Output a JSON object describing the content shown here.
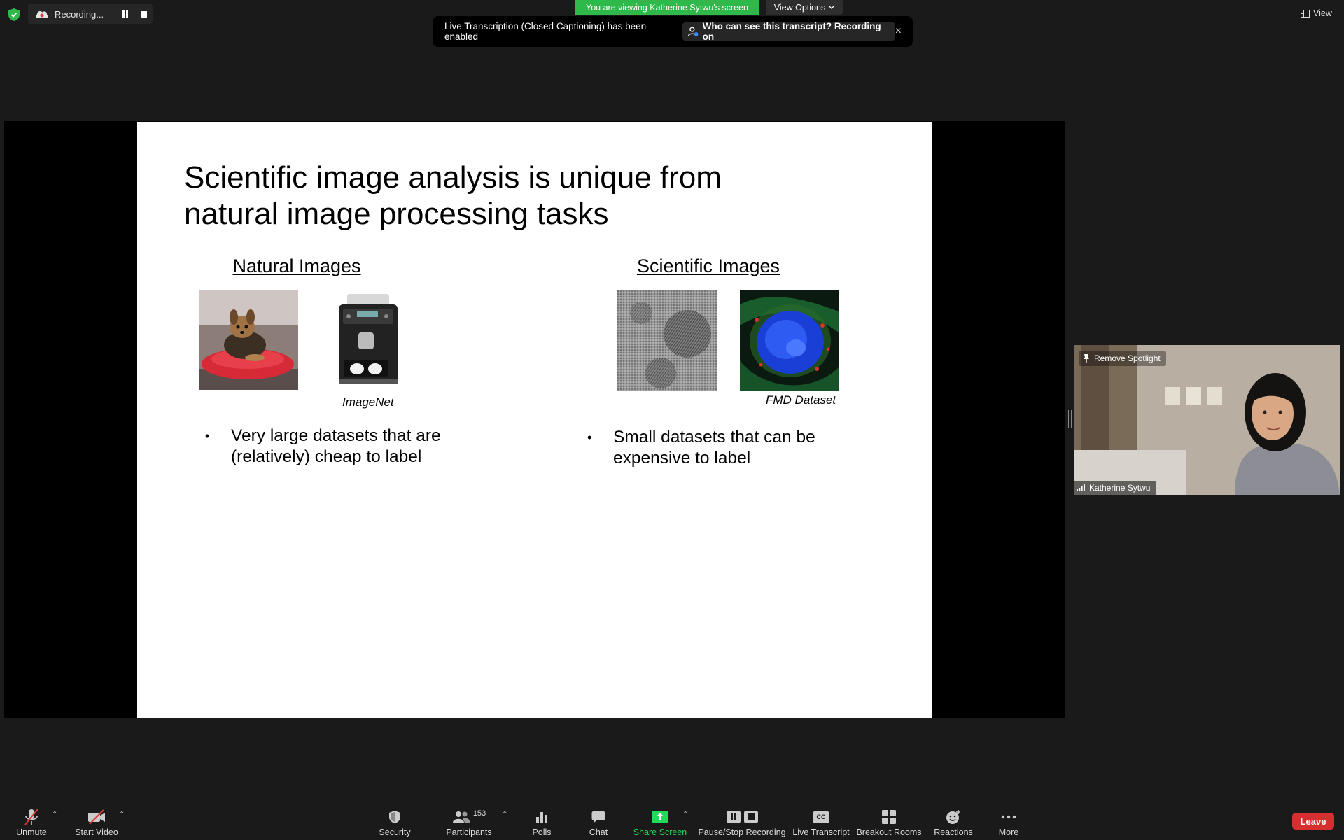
{
  "recording": {
    "label": "Recording..."
  },
  "banner": {
    "viewing": "You are viewing Katherine Sytwu's screen",
    "view_options": "View Options"
  },
  "transcript_notice": {
    "text": "Live Transcription (Closed Captioning) has been enabled",
    "who_label": "Who can see this transcript? Recording on",
    "close": "×"
  },
  "top_right": {
    "view_label": "View"
  },
  "slide": {
    "title_line1": "Scientific image analysis is unique from",
    "title_line2": "natural image processing tasks",
    "left_heading": "Natural Images",
    "left_caption": "ImageNet",
    "left_bullet_line1": "Very large datasets that are",
    "left_bullet_line2": "(relatively) cheap to label",
    "right_heading": "Scientific Images",
    "right_caption": "FMD Dataset",
    "right_bullet_line1": "Small datasets that can be",
    "right_bullet_line2": "expensive to label",
    "bullet_char": "•"
  },
  "video_tile": {
    "spotlight_label": "Remove Spotlight",
    "participant_name": "Katherine Sytwu"
  },
  "toolbar": {
    "unmute": "Unmute",
    "start_video": "Start Video",
    "security": "Security",
    "participants": "Participants",
    "participants_count": "153",
    "polls": "Polls",
    "chat": "Chat",
    "share_screen": "Share Screen",
    "pause_stop_recording": "Pause/Stop Recording",
    "live_transcript": "Live Transcript",
    "breakout_rooms": "Breakout Rooms",
    "reactions": "Reactions",
    "more": "More",
    "leave": "Leave",
    "cc_glyph": "CC"
  },
  "colors": {
    "background": "#1a1a1a",
    "banner_green": "#2fb94b",
    "share_green": "#23d959",
    "leave_red": "#d5302f"
  }
}
